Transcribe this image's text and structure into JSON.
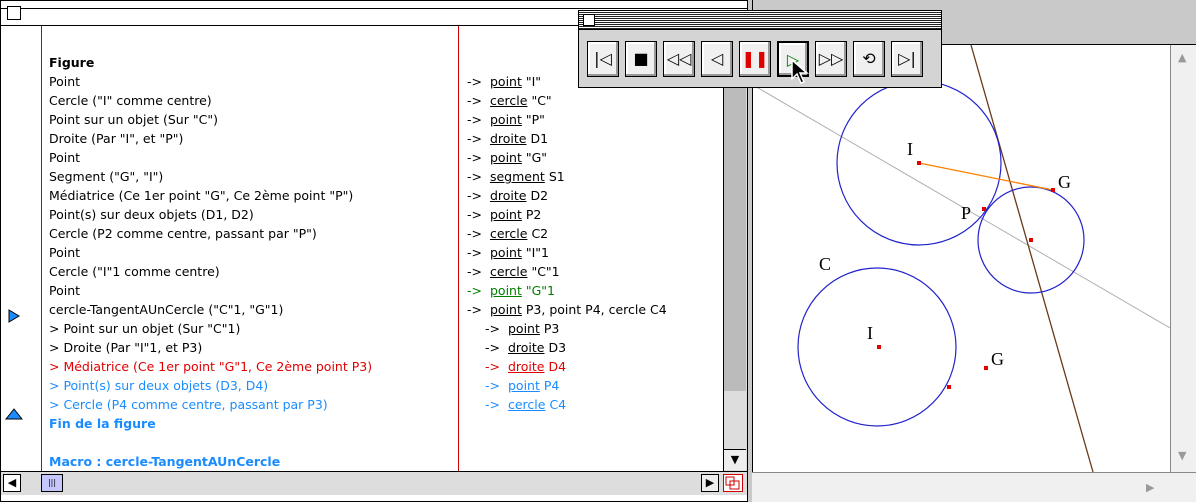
{
  "script_lines": [
    {
      "text": "Figure",
      "style": "bold"
    },
    {
      "text": "Point",
      "style": ""
    },
    {
      "text": "Cercle (\"I\" comme centre)",
      "style": ""
    },
    {
      "text": "Point sur un objet (Sur \"C\")",
      "style": ""
    },
    {
      "text": "Droite (Par \"I\", et \"P\")",
      "style": ""
    },
    {
      "text": "Point",
      "style": ""
    },
    {
      "text": "Segment (\"G\", \"I\")",
      "style": ""
    },
    {
      "text": "Médiatrice (Ce 1er point \"G\", Ce 2ème point \"P\")",
      "style": ""
    },
    {
      "text": "Point(s) sur deux objets (D1, D2)",
      "style": ""
    },
    {
      "text": "Cercle (P2 comme centre, passant par \"P\")",
      "style": ""
    },
    {
      "text": "Point",
      "style": ""
    },
    {
      "text": "Cercle (\"I\"1 comme centre)",
      "style": ""
    },
    {
      "text": "Point",
      "style": ""
    },
    {
      "text": "cercle-TangentAUnCercle (\"C\"1, \"G\"1)",
      "style": ""
    },
    {
      "text": "> Point sur un objet (Sur \"C\"1)",
      "style": ""
    },
    {
      "text": "> Droite (Par \"I\"1, et P3)",
      "style": ""
    },
    {
      "text": "> Médiatrice (Ce 1er point \"G\"1, Ce 2ème point P3)",
      "style": "red"
    },
    {
      "text": "> Point(s) sur deux objets (D3, D4)",
      "style": "blue"
    },
    {
      "text": "> Cercle (P4 comme centre, passant par P3)",
      "style": "blue"
    },
    {
      "text": "Fin de la figure",
      "style": "bold blue"
    },
    {
      "text": "",
      "style": ""
    },
    {
      "text": "Macro : cercle-TangentAUnCercle",
      "style": "bold blue"
    }
  ],
  "result_lines": [
    {
      "arrow": "->",
      "kind": "point",
      "name": "\"I\"",
      "color": ""
    },
    {
      "arrow": "->",
      "kind": "cercle",
      "name": "\"C\"",
      "color": ""
    },
    {
      "arrow": "->",
      "kind": "point",
      "name": "\"P\"",
      "color": ""
    },
    {
      "arrow": "->",
      "kind": "droite",
      "name": "D1",
      "color": ""
    },
    {
      "arrow": "->",
      "kind": "point",
      "name": "\"G\"",
      "color": ""
    },
    {
      "arrow": "->",
      "kind": "segment",
      "name": "S1",
      "color": ""
    },
    {
      "arrow": "->",
      "kind": "droite",
      "name": "D2",
      "color": ""
    },
    {
      "arrow": "->",
      "kind": "point",
      "name": "P2",
      "color": ""
    },
    {
      "arrow": "->",
      "kind": "cercle",
      "name": "C2",
      "color": ""
    },
    {
      "arrow": "->",
      "kind": "point",
      "name": "\"I\"1",
      "color": ""
    },
    {
      "arrow": "->",
      "kind": "cercle",
      "name": "\"C\"1",
      "color": ""
    },
    {
      "arrow": "->",
      "kind": "point",
      "name": "\"G\"1",
      "color": "green"
    },
    {
      "arrow": "->",
      "kind": "point",
      "name": "P3, point P4, cercle C4",
      "color": ""
    },
    {
      "arrow": "->",
      "kind": "point",
      "name": "P3",
      "color": ""
    },
    {
      "arrow": "->",
      "kind": "droite",
      "name": "D3",
      "color": ""
    },
    {
      "arrow": "->",
      "kind": "droite",
      "name": "D4",
      "color": "red"
    },
    {
      "arrow": "->",
      "kind": "point",
      "name": "P4",
      "color": "blue"
    },
    {
      "arrow": "->",
      "kind": "cercle",
      "name": "C4",
      "color": "blue"
    }
  ],
  "player_buttons": [
    {
      "name": "go-to-start-button",
      "glyph": "|◁"
    },
    {
      "name": "stop-button",
      "glyph": "■"
    },
    {
      "name": "fast-backward-button",
      "glyph": "◁◁"
    },
    {
      "name": "step-backward-button",
      "glyph": "◁"
    },
    {
      "name": "pause-button",
      "glyph": "❚❚"
    },
    {
      "name": "play-button",
      "glyph": "▷"
    },
    {
      "name": "fast-forward-button",
      "glyph": "▷▷"
    },
    {
      "name": "loop-button",
      "glyph": "⟲"
    },
    {
      "name": "go-to-end-button",
      "glyph": "▷|"
    }
  ],
  "figure_labels": {
    "I_top": "I",
    "G_top": "G",
    "P": "P",
    "C": "C",
    "I_bottom": "I",
    "G_bottom": "G"
  },
  "colors": {
    "red_text": "#e00000",
    "blue_text": "#1a8cff",
    "circle_stroke": "#2222cc",
    "brown_line": "#6b3a1a",
    "orange_segment": "#ff8000"
  }
}
